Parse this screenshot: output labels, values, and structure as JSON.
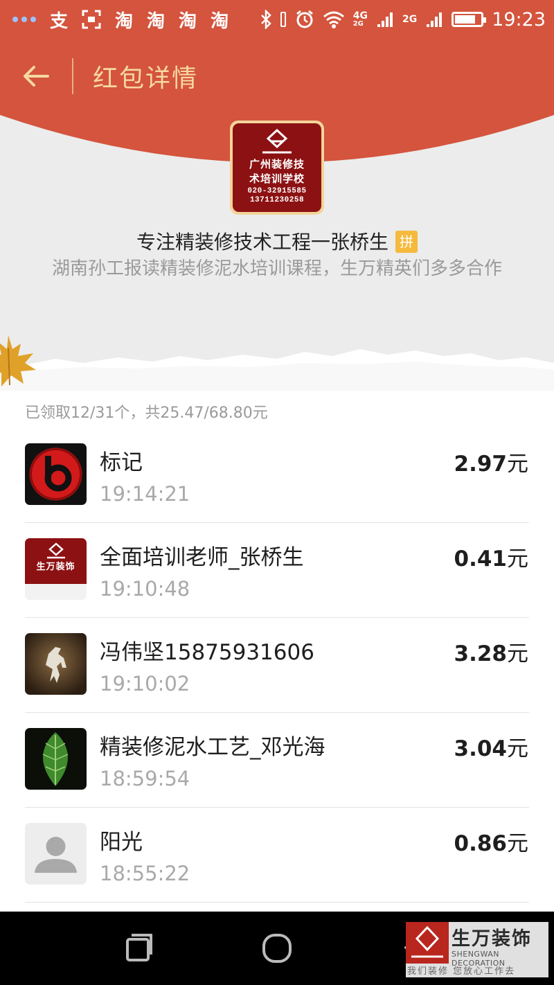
{
  "status_bar": {
    "notification_glyphs": [
      "支",
      "淘",
      "淘",
      "淘",
      "淘"
    ],
    "network_label_1": "4G",
    "network_label_2": "2G",
    "time": "19:23",
    "battery_level": 0.8
  },
  "header": {
    "title": "红包详情"
  },
  "sender": {
    "avatar_text_line1": "广州装修技",
    "avatar_text_line2": "术培训学校",
    "avatar_phone_1": "020-32915585",
    "avatar_phone_2": "13711230258",
    "name": "专注精装修技术工程一张桥生",
    "badge": "拼",
    "greeting": "湖南孙工报读精装修泥水培训课程，生万精英们多多合作"
  },
  "summary": "已领取12/31个，共25.47/68.80元",
  "recipients": [
    {
      "name": "标记",
      "time": "19:14:21",
      "amount": "2.97",
      "unit": "元"
    },
    {
      "name": "全面培训老师_张桥生",
      "time": "19:10:48",
      "amount": "0.41",
      "unit": "元",
      "avatar_text": "生万装饰"
    },
    {
      "name": "冯伟坚15875931606",
      "time": "19:10:02",
      "amount": "3.28",
      "unit": "元"
    },
    {
      "name": "精装修泥水工艺_邓光海",
      "time": "18:59:54",
      "amount": "3.04",
      "unit": "元"
    },
    {
      "name": "阳光",
      "time": "18:55:22",
      "amount": "0.86",
      "unit": "元"
    }
  ],
  "watermark": {
    "brand": "生万装饰",
    "english": "SHENGWAN DECORATION",
    "slogan": "我们装修 您放心工作去"
  },
  "colors": {
    "header_red": "#d4543d",
    "title_gold": "#f7d9a0",
    "badge_orange": "#f5b93c"
  }
}
